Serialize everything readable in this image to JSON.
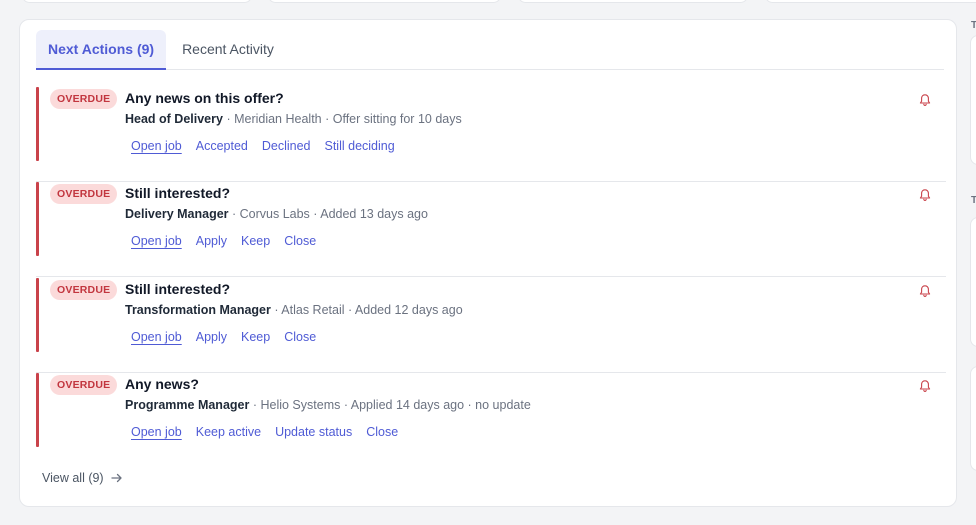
{
  "tabs": [
    {
      "label": "Next Actions (9)",
      "active": true
    },
    {
      "label": "Recent Activity",
      "active": false
    }
  ],
  "items": [
    {
      "badge": "OVERDUE",
      "title": "Any news on this offer?",
      "role": "Head of Delivery",
      "details": " · Meridian Health · Offer sitting for 10 days",
      "actions": [
        "Open job",
        "Accepted",
        "Declined",
        "Still deciding"
      ]
    },
    {
      "badge": "OVERDUE",
      "title": "Still interested?",
      "role": "Delivery Manager",
      "details": " · Corvus Labs · Added 13 days ago",
      "actions": [
        "Open job",
        "Apply",
        "Keep",
        "Close"
      ]
    },
    {
      "badge": "OVERDUE",
      "title": "Still interested?",
      "role": "Transformation Manager",
      "details": " · Atlas Retail · Added 12 days ago",
      "actions": [
        "Open job",
        "Apply",
        "Keep",
        "Close"
      ]
    },
    {
      "badge": "OVERDUE",
      "title": "Any news?",
      "role": "Programme Manager",
      "details": " · Helio Systems · Applied 14 days ago · no update",
      "actions": [
        "Open job",
        "Keep active",
        "Update status",
        "Close"
      ]
    }
  ],
  "view_all": "View all (9)",
  "colors": {
    "accent": "#4f5bd5",
    "overdue": "#c9424a",
    "badge_bg": "#fbdada"
  },
  "icons": {
    "bell": "bell-icon",
    "arrow": "arrow-right-icon"
  }
}
